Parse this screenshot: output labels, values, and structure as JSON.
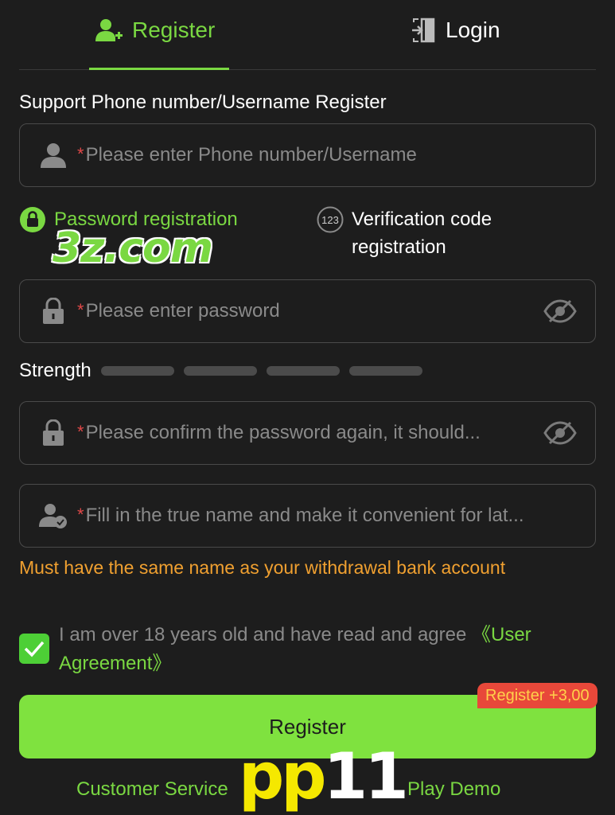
{
  "tabs": {
    "register": "Register",
    "login": "Login"
  },
  "form": {
    "section_title": "Support Phone number/Username Register",
    "required_mark": "*",
    "username_placeholder": "Please enter Phone number/Username",
    "password_placeholder": "Please enter password",
    "confirm_placeholder": "Please confirm the password again, it should...",
    "realname_placeholder": "Fill in the true name and make it convenient for lat...",
    "strength_label": "Strength",
    "strength_level": 0,
    "name_warning": "Must have the same name as your withdrawal bank account"
  },
  "methods": {
    "password": "Password registration",
    "code_badge": "123",
    "code": "Verification code registration"
  },
  "agreement": {
    "checked": true,
    "text": "I am over 18 years old and have read and agree ",
    "link": "《User Agreement》"
  },
  "actions": {
    "register_button": "Register",
    "bonus_badge": "Register +3,00",
    "customer_service": "Customer Service",
    "play_demo": "Play Demo"
  },
  "watermarks": {
    "site": "3z.com",
    "brand_yellow": "pp",
    "brand_white": "11"
  },
  "colors": {
    "accent": "#7ad842",
    "background": "#1d1d1d",
    "button": "#7fe23f",
    "warning": "#f0a030",
    "required": "#e04848",
    "badge": "#e8483a"
  }
}
